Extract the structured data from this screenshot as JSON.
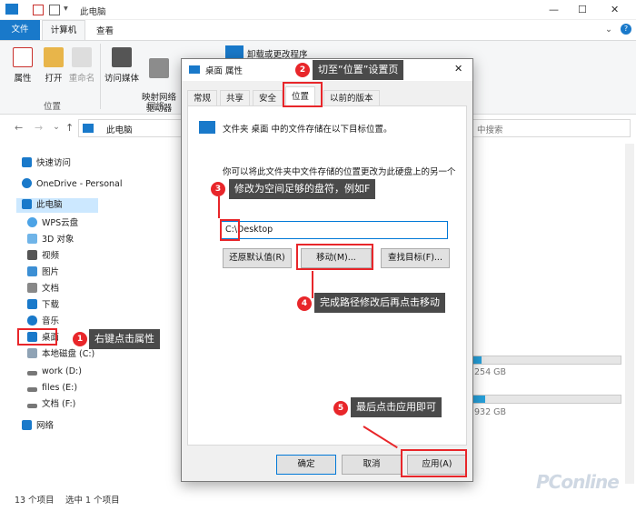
{
  "window": {
    "title": "此电脑",
    "minimize": "—",
    "maximize": "☐",
    "close": "✕"
  },
  "ribbon": {
    "tabs": {
      "file": "文件",
      "computer": "计算机",
      "view": "查看"
    },
    "buttons": {
      "properties": "属性",
      "open": "打开",
      "rename": "重命名",
      "media": "访问媒体",
      "map_drive": "映射网络\n驱动器",
      "uninstall": "卸载或更改程序"
    },
    "groups": {
      "location": "位置",
      "network": "网络"
    }
  },
  "address": {
    "path": "此电脑",
    "search_placeholder": "中搜索"
  },
  "nav": {
    "quick_access": "快速访问",
    "onedrive": "OneDrive - Personal",
    "this_pc": "此电脑",
    "wps": "WPS云盘",
    "objects3d": "3D 对象",
    "videos": "视频",
    "pictures": "图片",
    "documents": "文档",
    "downloads": "下载",
    "music": "音乐",
    "desktop": "桌面",
    "local_c": "本地磁盘 (C:)",
    "work_d": "work (D:)",
    "files_e": "files (E:)",
    "docs_f": "文档 (F:)",
    "network": "网络"
  },
  "drives": {
    "d_size": "254 GB",
    "e_size": "932 GB",
    "d_used": 0.08,
    "e_used": 0.1
  },
  "status": {
    "count": "13 个项目",
    "selected": "选中 1 个项目"
  },
  "dialog": {
    "title": "桌面 属性",
    "close": "✕",
    "tabs": {
      "general": "常规",
      "share": "共享",
      "security": "安全",
      "location": "位置",
      "previous": "以前的版本"
    },
    "info": "文件夹 桌面 中的文件存储在以下目标位置。",
    "desc": "你可以将此文件夹中文件存储的位置更改为此硬盘上的另一个",
    "path_value": "C:\\Desktop",
    "btn_restore": "还原默认值(R)",
    "btn_move": "移动(M)...",
    "btn_find": "查找目标(F)...",
    "btn_ok": "确定",
    "btn_cancel": "取消",
    "btn_apply": "应用(A)"
  },
  "annotations": {
    "n1": "1",
    "n2": "2",
    "n3": "3",
    "n4": "4",
    "n5": "5",
    "a1": "右键点击属性",
    "a2": "切至“位置”设置页",
    "a3": "修改为空间足够的盘符，例如F",
    "a4": "完成路径修改后再点击移动",
    "a5": "最后点击应用即可"
  },
  "watermark": "PConline",
  "colors": {
    "accent": "#1979ca",
    "annotation_red": "#e8262a",
    "callout_bg": "#4a4a4a"
  }
}
